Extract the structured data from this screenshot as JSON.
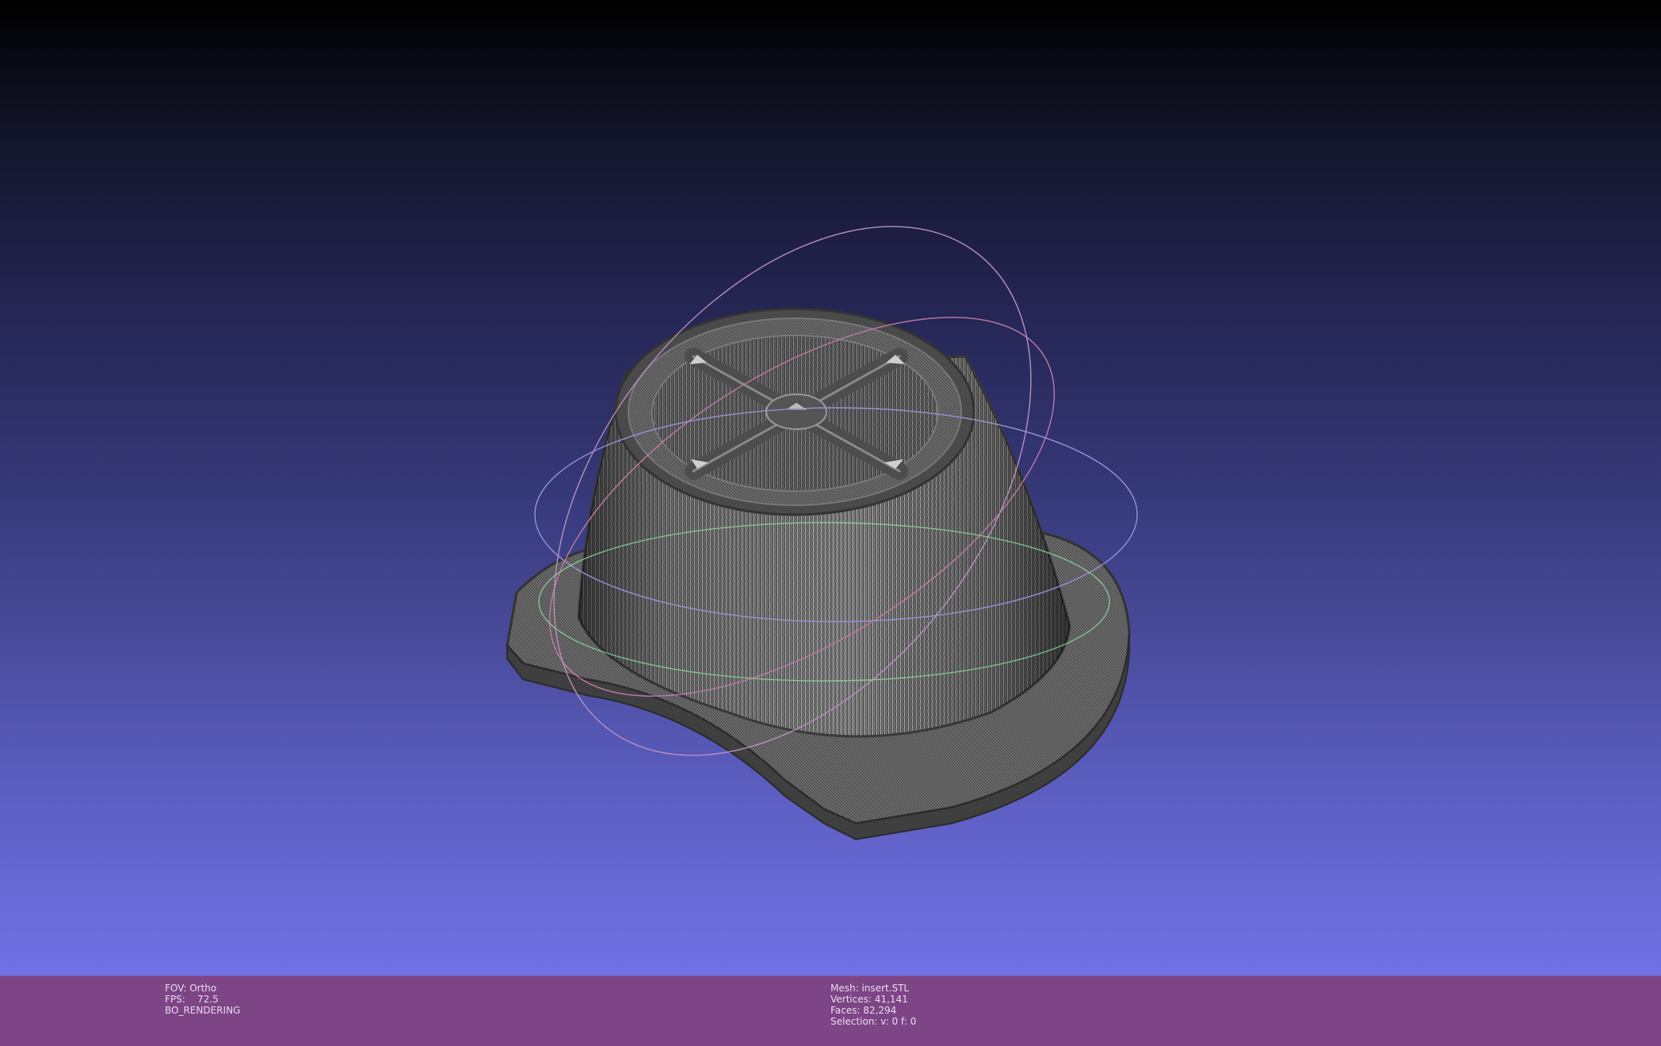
{
  "viewer": {
    "background_top": "#000000",
    "background_bottom": "#7072e6",
    "mesh_color": "#4a4a4a",
    "wire_color": "#d9d9d9",
    "trackball": {
      "x_ring_color": "#c86a9c",
      "y_ring_color": "#8a7fd0",
      "z_ring_color": "#7fd68a"
    }
  },
  "status": {
    "bar_color": "#7d4585",
    "left": {
      "fov": "FOV: Ortho",
      "fps": "FPS:    72.5",
      "rendering": "BO_RENDERING"
    },
    "right": {
      "mesh": "Mesh: insert.STL",
      "vertices": "Vertices: 41,141",
      "faces": "Faces: 82,294",
      "selection": "Selection: v: 0 f: 0"
    }
  }
}
